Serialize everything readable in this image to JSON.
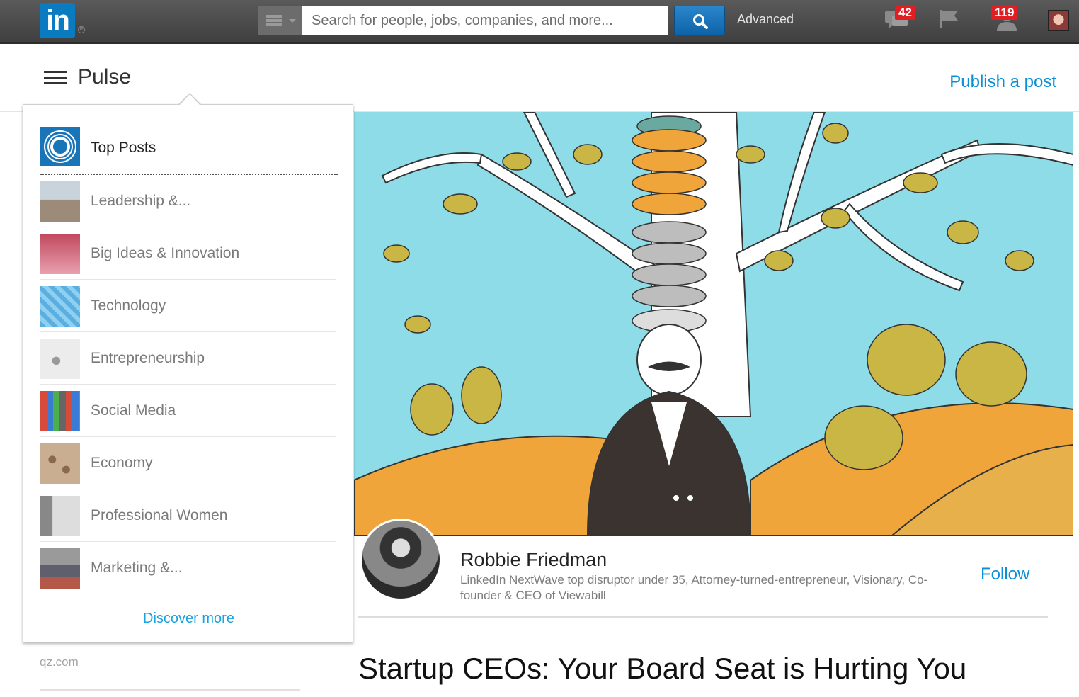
{
  "topbar": {
    "logo_text": "in",
    "search": {
      "placeholder": "Search for people, jobs, companies, and more..."
    },
    "advanced_label": "Advanced",
    "messages_badge": "42",
    "notifications_badge": "119"
  },
  "pulse": {
    "title": "Pulse",
    "publish_label": "Publish a post"
  },
  "menu": {
    "top_posts_label": "Top Posts",
    "items": [
      {
        "label": "Leadership &..."
      },
      {
        "label": "Big Ideas & Innovation"
      },
      {
        "label": "Technology"
      },
      {
        "label": "Entrepreneurship"
      },
      {
        "label": "Social Media"
      },
      {
        "label": "Economy"
      },
      {
        "label": "Professional Women"
      },
      {
        "label": "Marketing &..."
      }
    ],
    "discover_label": "Discover more"
  },
  "sidebar": {
    "source": "qz.com"
  },
  "author": {
    "name": "Robbie Friedman",
    "bio": "LinkedIn NextWave top disruptor under 35, Attorney-turned-entrepreneur, Visionary, Co-founder & CEO of Viewabill",
    "follow_label": "Follow"
  },
  "article": {
    "title": "Startup CEOs: Your Board Seat is Hurting You"
  },
  "colors": {
    "linkedin_blue": "#0a7bc1",
    "link_blue": "#0b8fd6",
    "badge_red": "#e01e24"
  }
}
